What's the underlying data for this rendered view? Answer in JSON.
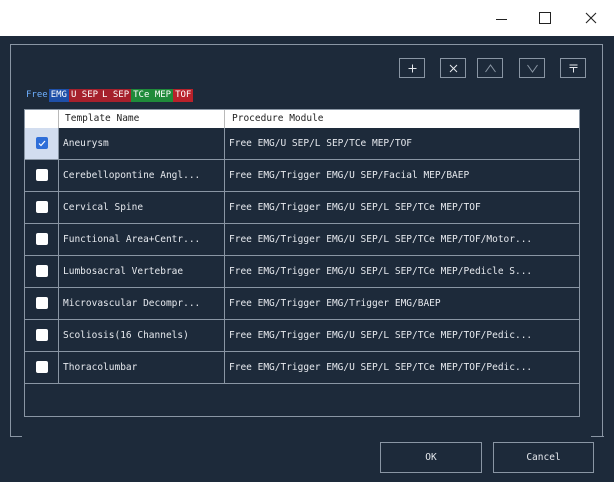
{
  "window": {
    "controls": [
      "minimize-icon",
      "maximize-icon",
      "close-icon"
    ]
  },
  "toolbar": {
    "buttons": [
      {
        "name": "add-template-button",
        "icon": "plus-icon"
      },
      {
        "name": "delete-template-button",
        "icon": "x-icon"
      },
      {
        "name": "move-up-button",
        "icon": "chevron-up-icon"
      },
      {
        "name": "move-down-button",
        "icon": "chevron-down-icon"
      },
      {
        "name": "move-to-top-button",
        "icon": "move-top-icon"
      }
    ]
  },
  "legend": [
    {
      "label": "Free",
      "color": "",
      "style": "plain"
    },
    {
      "label": "EMG",
      "color": "#1e4fa8"
    },
    {
      "label": "U SEP",
      "color": "#a5202c"
    },
    {
      "label": "L SEP",
      "color": "#a5202c"
    },
    {
      "label": "TCe MEP",
      "color": "#1f8a3a"
    },
    {
      "label": "TOF",
      "color": "#b8212a"
    }
  ],
  "table": {
    "columns": [
      "",
      "Template Name",
      "Procedure Module"
    ],
    "rows": [
      {
        "checked": true,
        "name": "Aneurysm",
        "module": "Free EMG/U SEP/L SEP/TCe MEP/TOF"
      },
      {
        "checked": false,
        "name": "Cerebellopontine Angl...",
        "module": "Free EMG/Trigger EMG/U SEP/Facial MEP/BAEP"
      },
      {
        "checked": false,
        "name": "Cervical Spine",
        "module": "Free EMG/Trigger EMG/U SEP/L SEP/TCe MEP/TOF"
      },
      {
        "checked": false,
        "name": "Functional Area+Centr...",
        "module": "Free EMG/Trigger EMG/U SEP/L SEP/TCe MEP/TOF/Motor..."
      },
      {
        "checked": false,
        "name": "Lumbosacral Vertebrae",
        "module": "Free EMG/Trigger EMG/U SEP/L SEP/TCe MEP/Pedicle S..."
      },
      {
        "checked": false,
        "name": "Microvascular Decompr...",
        "module": "Free EMG/Trigger EMG/Trigger EMG/BAEP"
      },
      {
        "checked": false,
        "name": "Scoliosis(16 Channels)",
        "module": "Free EMG/Trigger EMG/U SEP/L SEP/TCe MEP/TOF/Pedic..."
      },
      {
        "checked": false,
        "name": "Thoracolumbar",
        "module": "Free EMG/Trigger EMG/U SEP/L SEP/TCe MEP/TOF/Pedic..."
      }
    ]
  },
  "footer": {
    "ok_label": "OK",
    "cancel_label": "Cancel"
  },
  "colors": {
    "background": "#1d2a3a",
    "border": "#8a96a4",
    "checkbox_checked": "#2f6ed8",
    "header_bg": "#ffffff"
  }
}
